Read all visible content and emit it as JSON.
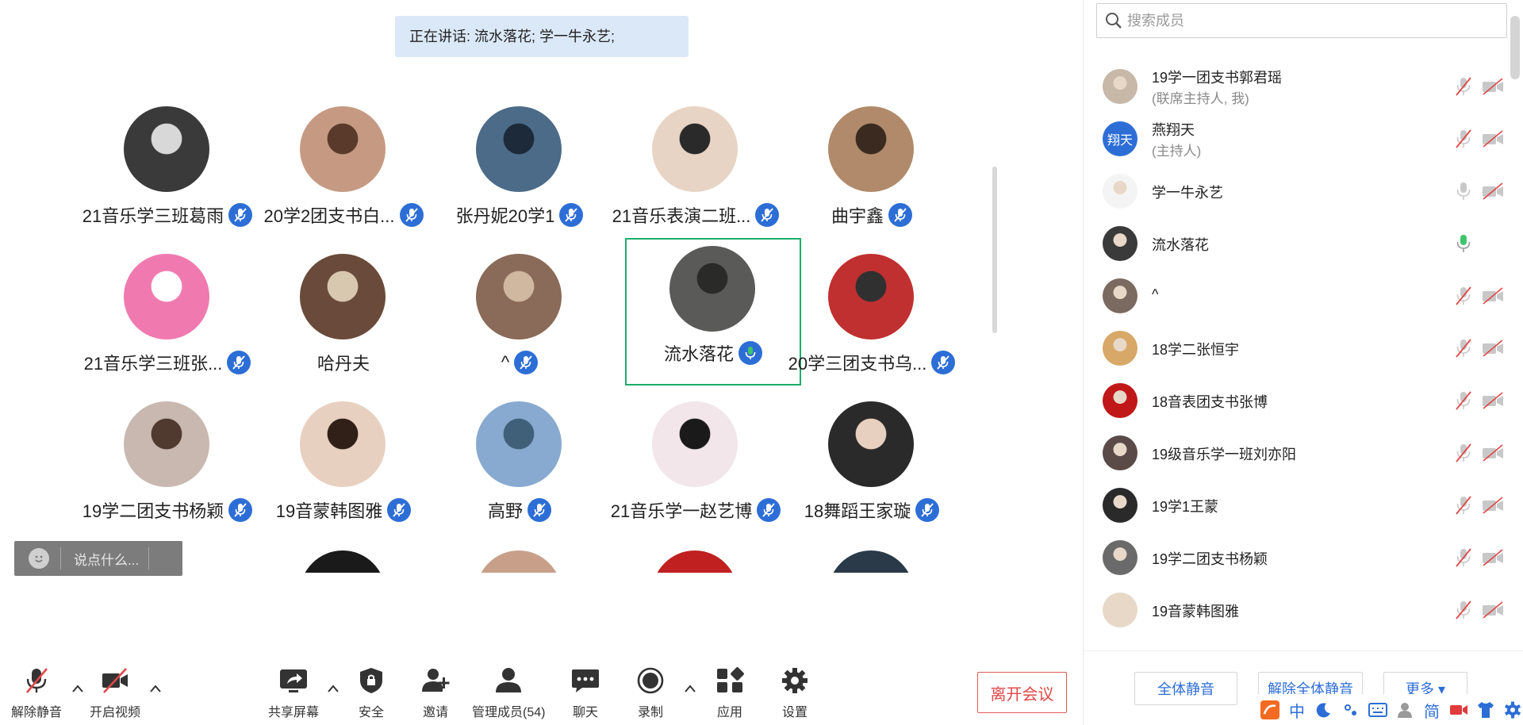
{
  "speaking_banner": "正在讲话: 流水落花; 学一牛永艺;",
  "colors": {
    "accent": "#2d6ed6",
    "active_border": "#1aad6a",
    "leave": "#e04848",
    "mic_active": "#3cc56b"
  },
  "tiles": [
    {
      "name": "21音乐学三班葛雨",
      "mic": "muted"
    },
    {
      "name": "20学2团支书白...",
      "mic": "muted"
    },
    {
      "name": "张丹妮20学1",
      "mic": "muted"
    },
    {
      "name": "21音乐表演二班...",
      "mic": "muted"
    },
    {
      "name": "曲宇鑫",
      "mic": "muted"
    },
    {
      "name": "21音乐学三班张...",
      "mic": "muted"
    },
    {
      "name": "哈丹夫",
      "mic": "none"
    },
    {
      "name": "^",
      "mic": "muted"
    },
    {
      "name": "流水落花",
      "mic": "speaking",
      "active": true
    },
    {
      "name": "20学三团支书乌...",
      "mic": "muted"
    },
    {
      "name": "19学二团支书杨颖",
      "mic": "muted"
    },
    {
      "name": "19音蒙韩图雅",
      "mic": "muted"
    },
    {
      "name": "高野",
      "mic": "muted"
    },
    {
      "name": "21音乐学一赵艺博",
      "mic": "muted"
    },
    {
      "name": "18舞蹈王家璇",
      "mic": "muted"
    }
  ],
  "chat": {
    "placeholder": "说点什么..."
  },
  "toolbar": {
    "unmute": "解除静音",
    "start_video": "开启视频",
    "share_screen": "共享屏幕",
    "security": "安全",
    "invite": "邀请",
    "manage_members": "管理成员(54)",
    "chat": "聊天",
    "record": "录制",
    "apps": "应用",
    "settings": "设置",
    "leave": "离开会议"
  },
  "panel": {
    "search_placeholder": "搜索成员",
    "members": [
      {
        "name": "19学一团支书郭君瑶",
        "role": "(联席主持人, 我)",
        "mic": "muted",
        "cam": "off"
      },
      {
        "name": "燕翔天",
        "role": "(主持人)",
        "mic": "muted",
        "cam": "off",
        "avatar_text": "翔天"
      },
      {
        "name": "学一牛永艺",
        "role": "",
        "mic": "on-gray",
        "cam": "off"
      },
      {
        "name": "流水落花",
        "role": "",
        "mic": "speaking",
        "cam": "none"
      },
      {
        "name": "^",
        "role": "",
        "mic": "muted",
        "cam": "off"
      },
      {
        "name": "18学二张恒宇",
        "role": "",
        "mic": "muted",
        "cam": "off"
      },
      {
        "name": "18音表团支书张博",
        "role": "",
        "mic": "muted",
        "cam": "off"
      },
      {
        "name": "19级音乐学一班刘亦阳",
        "role": "",
        "mic": "muted",
        "cam": "off"
      },
      {
        "name": "19学1王蒙",
        "role": "",
        "mic": "muted",
        "cam": "off"
      },
      {
        "name": "19学二团支书杨颖",
        "role": "",
        "mic": "muted",
        "cam": "off"
      },
      {
        "name": "19音蒙韩图雅",
        "role": "",
        "mic": "muted",
        "cam": "off"
      }
    ],
    "mute_all": "全体静音",
    "unmute_all": "解除全体静音",
    "more": "更多 ▾"
  },
  "ime": {
    "mode": "中",
    "simplified": "简"
  }
}
